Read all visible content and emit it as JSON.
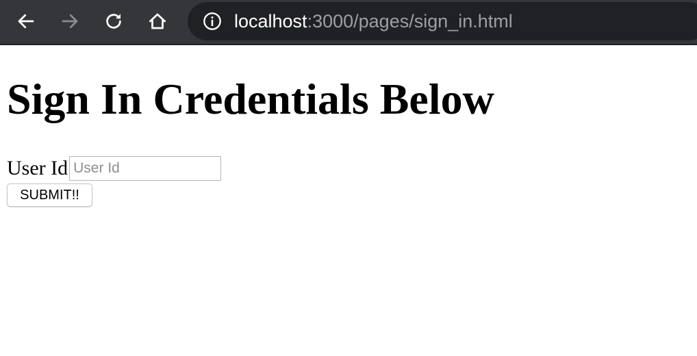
{
  "browser": {
    "url_host": "localhost",
    "url_rest": ":3000/pages/sign_in.html",
    "icons": {
      "back": "arrow-left",
      "forward": "arrow-right",
      "reload": "reload",
      "home": "home",
      "info": "info-circle"
    },
    "colors": {
      "toolbar_bg": "#35363a",
      "omnibox_bg": "#202124",
      "host_text": "#ffffff",
      "path_text": "#9aa0a6"
    }
  },
  "page": {
    "heading": "Sign In Credentials Below",
    "user_id_label": "User Id",
    "user_id_placeholder": "User Id",
    "user_id_value": "",
    "submit_label": "SUBMIT!!"
  }
}
